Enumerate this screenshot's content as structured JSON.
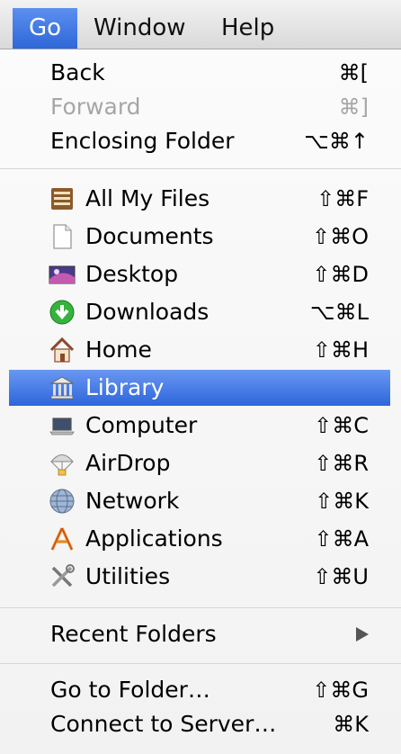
{
  "menubar": {
    "go": "Go",
    "window": "Window",
    "help": "Help"
  },
  "menu": {
    "back": {
      "label": "Back",
      "shortcut": "⌘["
    },
    "forward": {
      "label": "Forward",
      "shortcut": "⌘]"
    },
    "enclosing": {
      "label": "Enclosing Folder",
      "shortcut": "⌥⌘↑"
    },
    "all_my_files": {
      "label": "All My Files",
      "shortcut": "⇧⌘F"
    },
    "documents": {
      "label": "Documents",
      "shortcut": "⇧⌘O"
    },
    "desktop": {
      "label": "Desktop",
      "shortcut": "⇧⌘D"
    },
    "downloads": {
      "label": "Downloads",
      "shortcut": "⌥⌘L"
    },
    "home": {
      "label": "Home",
      "shortcut": "⇧⌘H"
    },
    "library": {
      "label": "Library",
      "shortcut": ""
    },
    "computer": {
      "label": "Computer",
      "shortcut": "⇧⌘C"
    },
    "airdrop": {
      "label": "AirDrop",
      "shortcut": "⇧⌘R"
    },
    "network": {
      "label": "Network",
      "shortcut": "⇧⌘K"
    },
    "applications": {
      "label": "Applications",
      "shortcut": "⇧⌘A"
    },
    "utilities": {
      "label": "Utilities",
      "shortcut": "⇧⌘U"
    },
    "recent": {
      "label": "Recent Folders"
    },
    "go_to_folder": {
      "label": "Go to Folder…",
      "shortcut": "⇧⌘G"
    },
    "connect": {
      "label": "Connect to Server…",
      "shortcut": "⌘K"
    }
  },
  "colors": {
    "accent": "#2f67d8",
    "disabled": "#a6a6a6"
  }
}
